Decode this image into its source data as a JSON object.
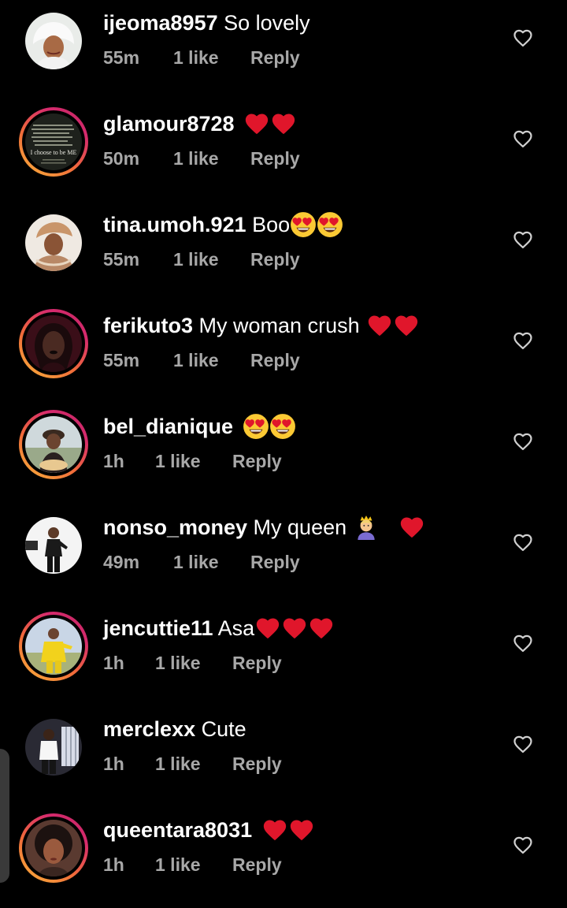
{
  "comments": [
    {
      "username": "ijeoma8957",
      "text": "So lovely",
      "emoji": "",
      "time": "55m",
      "likes": "1 like",
      "reply": "Reply",
      "story": false
    },
    {
      "username": "glamour8728",
      "text": "",
      "emoji": "red-heart-x2",
      "time": "50m",
      "likes": "1 like",
      "reply": "Reply",
      "story": true
    },
    {
      "username": "tina.umoh.921",
      "text": "Boo",
      "emoji": "heart-eyes-x2",
      "time": "55m",
      "likes": "1 like",
      "reply": "Reply",
      "story": false
    },
    {
      "username": "ferikuto3",
      "text": "My woman crush",
      "emoji": "red-heart-x2",
      "time": "55m",
      "likes": "1 like",
      "reply": "Reply",
      "story": true
    },
    {
      "username": "bel_dianique",
      "text": "",
      "emoji": "heart-eyes-x2",
      "time": "1h",
      "likes": "1 like",
      "reply": "Reply",
      "story": true
    },
    {
      "username": "nonso_money",
      "text": "My queen",
      "emoji": "princess-red-heart",
      "time": "49m",
      "likes": "1 like",
      "reply": "Reply",
      "story": false
    },
    {
      "username": "jencuttie11",
      "text": "Asa",
      "emoji": "red-heart-x3",
      "time": "1h",
      "likes": "1 like",
      "reply": "Reply",
      "story": true
    },
    {
      "username": "merclexx",
      "text": "Cute",
      "emoji": "",
      "time": "1h",
      "likes": "1 like",
      "reply": "Reply",
      "story": false
    },
    {
      "username": "queentara8031",
      "text": "",
      "emoji": "red-heart-x2",
      "time": "1h",
      "likes": "1 like",
      "reply": "Reply",
      "story": true
    }
  ],
  "avatar_story_text": "I choose to be ME",
  "colors": {
    "background": "#000000",
    "secondary_text": "#a8a8a8",
    "heart": "#e0162b",
    "story_ring_start": "#f9b53a",
    "story_ring_end": "#c1275f"
  },
  "icons": {
    "like": "heart-outline-icon"
  }
}
